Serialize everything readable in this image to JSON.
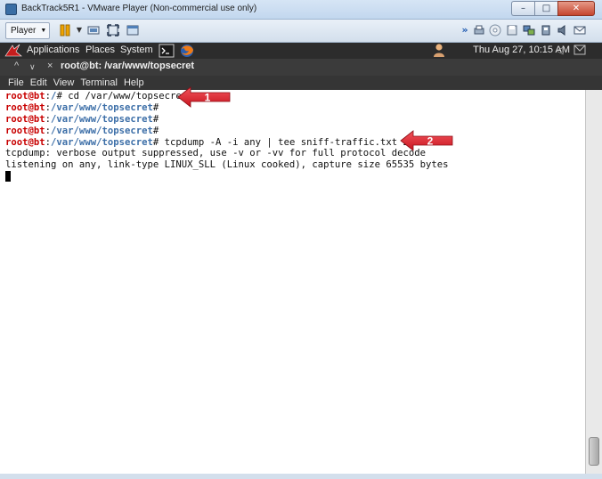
{
  "window": {
    "title": "BackTrack5R1 - VMware Player (Non-commercial use only)",
    "controls": [
      "–",
      "□",
      "✕"
    ]
  },
  "vm_toolbar": {
    "player_label": "Player",
    "icons": [
      "pause-icon",
      "send-ctrl-alt-del-icon",
      "fullscreen-icon",
      "unity-icon",
      "devices-icon"
    ]
  },
  "panel": {
    "applications": "Applications",
    "places": "Places",
    "system": "System",
    "clock": "Thu Aug 27, 10:15 AM"
  },
  "terminal": {
    "window_title": "root@bt: /var/www/topsecret",
    "menu": [
      "File",
      "Edit",
      "View",
      "Terminal",
      "Help"
    ],
    "lines": [
      {
        "user": "root@bt",
        "path": "/",
        "cmd": " cd /var/www/topsecret"
      },
      {
        "user": "root@bt",
        "path": "/var/www/topsecret",
        "cmd": ""
      },
      {
        "user": "root@bt",
        "path": "/var/www/topsecret",
        "cmd": ""
      },
      {
        "user": "root@bt",
        "path": "/var/www/topsecret",
        "cmd": ""
      },
      {
        "user": "root@bt",
        "path": "/var/www/topsecret",
        "cmd": " tcpdump -A -i any | tee sniff-traffic.txt 2>&1"
      }
    ],
    "output": [
      "tcpdump: verbose output suppressed, use -v or -vv for full protocol decode",
      "listening on any, link-type LINUX_SLL (Linux cooked), capture size 65535 bytes"
    ]
  },
  "annotations": [
    {
      "label": "1",
      "color": "#e0202a"
    },
    {
      "label": "2",
      "color": "#e0202a"
    }
  ]
}
